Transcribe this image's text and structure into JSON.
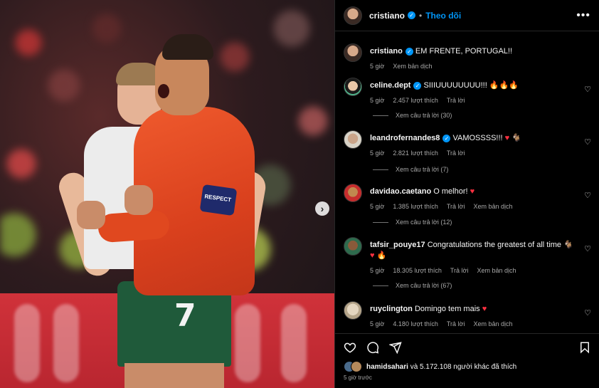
{
  "post": {
    "author": "cristiano",
    "follow_label": "Theo dõi",
    "caption": "EM FRENTE, PORTUGAL!!",
    "caption_time": "5 giờ",
    "caption_translate": "Xem bản dịch",
    "liked_by_user": "hamidsahari",
    "liked_by_rest": "và 5.172.108 người khác đã thích",
    "posted_ago": "5 giờ trước",
    "jersey_number": "7",
    "armband_text": "RESPECT"
  },
  "labels": {
    "likes_suffix": "lượt thích",
    "reply": "Trả lời",
    "translate": "Xem bản dịch"
  },
  "comments": [
    {
      "user": "celine.dept",
      "verified": true,
      "text": "SIIIUUUUUUUU!!! 🔥🔥🔥",
      "time": "5 giờ",
      "likes": "2.457 lượt thích",
      "reply": "Trả lời",
      "replies": "Xem câu trả lời (30)"
    },
    {
      "user": "leandrofernandes8",
      "verified": true,
      "text": "VAMOSSSS!!! ♥ 🐐",
      "time": "5 giờ",
      "likes": "2.821 lượt thích",
      "reply": "Trả lời",
      "replies": "Xem câu trả lời (7)"
    },
    {
      "user": "davidao.caetano",
      "verified": false,
      "text": "O melhor! ♥",
      "time": "5 giờ",
      "likes": "1.385 lượt thích",
      "reply": "Trả lời",
      "translate": "Xem bản dịch",
      "replies": "Xem câu trả lời (12)"
    },
    {
      "user": "tafsir_pouye17",
      "verified": false,
      "text": "Congratulations the greatest of all time 🐐 ♥ 🔥",
      "time": "5 giờ",
      "likes": "18.305 lượt thích",
      "reply": "Trả lời",
      "translate": "Xem bản dịch",
      "replies": "Xem câu trả lời (67)"
    },
    {
      "user": "ruyclington",
      "verified": false,
      "text": "Domingo tem mais ♥",
      "time": "5 giờ",
      "likes": "4.180 lượt thích",
      "reply": "Trả lời",
      "translate": "Xem bản dịch"
    }
  ],
  "icons": {
    "more": "more-options-icon",
    "like": "heart-icon",
    "comment": "comment-icon",
    "share": "share-icon",
    "save": "bookmark-icon",
    "next": "chevron-right-icon",
    "verified": "verified-badge-icon"
  },
  "colors": {
    "background": "#000000",
    "accent": "#0095f6",
    "muted_text": "#a8a8a8",
    "heart_red": "#ff3040"
  }
}
